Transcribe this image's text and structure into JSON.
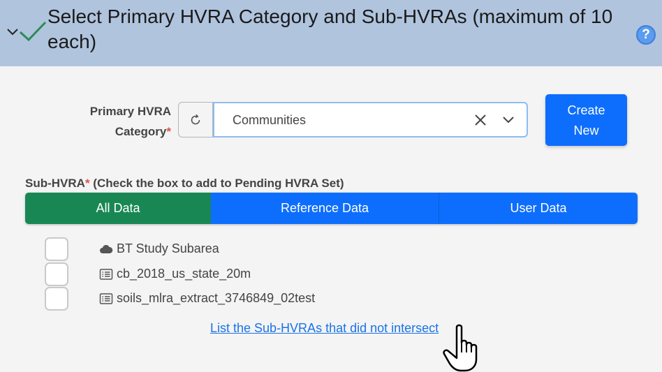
{
  "header": {
    "title": "Select Primary HVRA Category and Sub-HVRAs (maximum of 10 each)",
    "help_label": "?"
  },
  "primary": {
    "label_line1": "Primary HVRA",
    "label_line2": "Category",
    "required_mark": "*",
    "selected_value": "Communities",
    "create_line1": "Create",
    "create_line2": "New"
  },
  "sub": {
    "label": "Sub-HVRA",
    "required_mark": "*",
    "instructions": " (Check the box to add to Pending HVRA Set)"
  },
  "tabs": [
    {
      "label": "All Data",
      "active": true
    },
    {
      "label": "Reference Data",
      "active": false
    },
    {
      "label": "User Data",
      "active": false
    }
  ],
  "items": [
    {
      "label": "BT Study Subarea",
      "icon": "cloud-icon",
      "checked": false
    },
    {
      "label": "cb_2018_us_state_20m",
      "icon": "list-icon",
      "checked": false
    },
    {
      "label": "soils_mlra_extract_3746849_02test",
      "icon": "list-icon",
      "checked": false
    }
  ],
  "link_text": "List the Sub-HVRAs that did not intersect",
  "colors": {
    "header_bg": "#b0c4de",
    "active_tab": "#198754",
    "primary_btn": "#0d6efd",
    "check_green": "#2e8b57"
  }
}
